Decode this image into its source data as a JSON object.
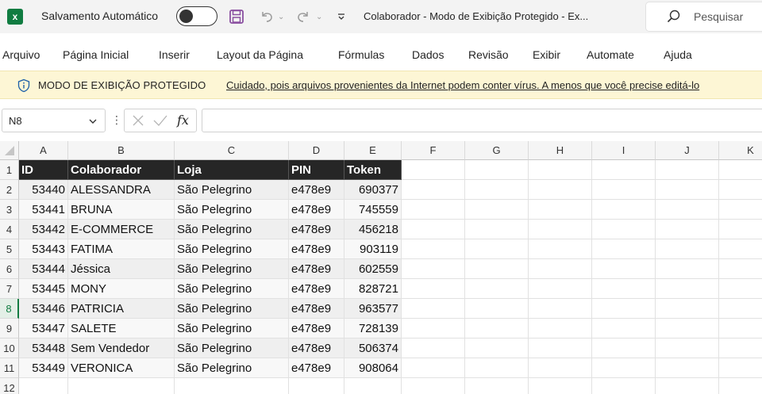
{
  "titlebar": {
    "app_icon": "excel-icon",
    "autosave_label": "Salvamento Automático",
    "autosave_state": "off",
    "document_title": "Colaborador  -  Modo de Exibição Protegido  -  Ex...",
    "search_placeholder": "Pesquisar"
  },
  "menu": {
    "items": [
      "Arquivo",
      "Página Inicial",
      "Inserir",
      "Layout da Página",
      "Fórmulas",
      "Dados",
      "Revisão",
      "Exibir",
      "Automate",
      "Ajuda"
    ]
  },
  "banner": {
    "icon": "info-shield-icon",
    "title": "MODO DE EXIBIÇÃO PROTEGIDO",
    "message": "Cuidado, pois arquivos provenientes da Internet podem conter vírus. A menos que você precise editá-lo"
  },
  "formula_bar": {
    "name_box": "N8",
    "dots": "⋮",
    "fx": "fx",
    "formula": ""
  },
  "grid": {
    "columns": [
      "A",
      "B",
      "C",
      "D",
      "E",
      "F",
      "G",
      "H",
      "I",
      "J",
      "K"
    ],
    "row_numbers": [
      "1",
      "2",
      "3",
      "4",
      "5",
      "6",
      "7",
      "8",
      "9",
      "10",
      "11",
      "12"
    ],
    "active_row": 8,
    "header": [
      "ID",
      "Colaborador",
      "Loja",
      "PIN",
      "Token"
    ],
    "rows": [
      [
        "53440",
        "ALESSANDRA",
        "São Pelegrino",
        "e478e9",
        "690377"
      ],
      [
        "53441",
        "BRUNA",
        "São Pelegrino",
        "e478e9",
        "745559"
      ],
      [
        "53442",
        "E-COMMERCE",
        "São Pelegrino",
        "e478e9",
        "456218"
      ],
      [
        "53443",
        "FATIMA",
        "São Pelegrino",
        "e478e9",
        "903119"
      ],
      [
        "53444",
        "Jéssica",
        "São Pelegrino",
        "e478e9",
        "602559"
      ],
      [
        "53445",
        "MONY",
        "São Pelegrino",
        "e478e9",
        "828721"
      ],
      [
        "53446",
        "PATRICIA",
        "São Pelegrino",
        "e478e9",
        "963577"
      ],
      [
        "53447",
        "SALETE",
        "São Pelegrino",
        "e478e9",
        "728139"
      ],
      [
        "53448",
        "Sem Vendedor",
        "São Pelegrino",
        "e478e9",
        "506374"
      ],
      [
        "53449",
        "VERONICA",
        "São Pelegrino",
        "e478e9",
        "908064"
      ]
    ]
  },
  "colors": {
    "accent": "#107c41",
    "header_fill": "#262626",
    "banner_fill": "#fdf6d5",
    "save_icon": "#8a4fa0"
  }
}
